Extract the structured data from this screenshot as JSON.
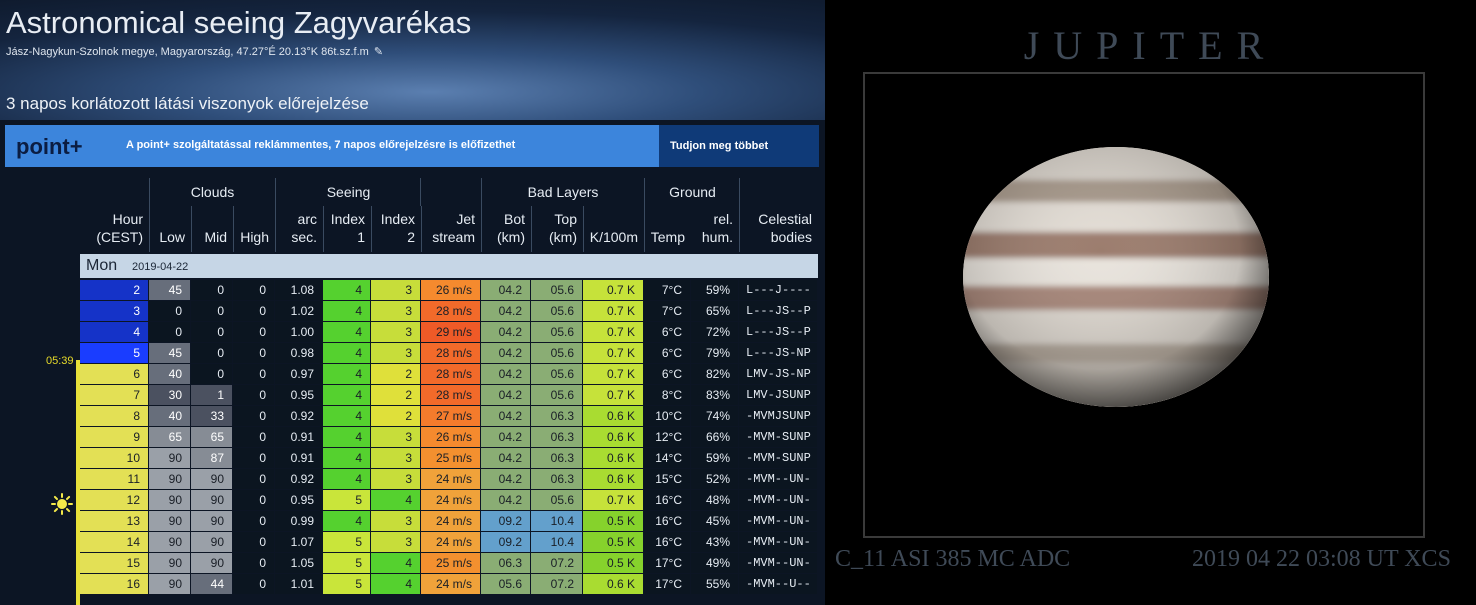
{
  "site": {
    "title": "Astronomical seeing Zagyvarékas",
    "location": "Jász-Nagykun-Szolnok megye, Magyarország, 47.27°É 20.13°K 86t.sz.f.m",
    "edit_icon": "edit-icon"
  },
  "forecast": {
    "heading": "3 napos korlátozott látási viszonyok előrejelzése"
  },
  "promo": {
    "logo": "point+",
    "text": "A point+ szolgáltatással reklámmentes, 7 napos előrejelzésre is előfizethet",
    "link": "Tudjon meg többet"
  },
  "table": {
    "group_headers": [
      "Clouds",
      "Seeing",
      "Bad Layers",
      "Ground"
    ],
    "headers": {
      "hour": [
        "Hour",
        "(CEST)"
      ],
      "low": "Low",
      "mid": "Mid",
      "high": "High",
      "arc": [
        "arc",
        "sec."
      ],
      "index1": [
        "Index",
        "1"
      ],
      "index2": [
        "Index",
        "2"
      ],
      "jet": [
        "Jet",
        "stream"
      ],
      "bot": [
        "Bot",
        "(km)"
      ],
      "top": [
        "Top",
        "(km)"
      ],
      "k100": "K/100m",
      "temp": "Temp",
      "hum": [
        "rel.",
        "hum."
      ],
      "celestial": [
        "Celestial",
        "bodies"
      ]
    },
    "day": {
      "name": "Mon",
      "date": "2019-04-22"
    },
    "sunrise": "05:39",
    "sun_icon": "sun-icon",
    "rows": [
      {
        "hour": "2",
        "low": "45",
        "mid": "0",
        "high": "0",
        "arc": "1.08",
        "i1": "4",
        "i2": "3",
        "jet": "26 m/s",
        "bot": "04.2",
        "top": "05.6",
        "k": "0.7 K",
        "temp": "7°C",
        "hum": "59%",
        "bodies": "L---J----"
      },
      {
        "hour": "3",
        "low": "0",
        "mid": "0",
        "high": "0",
        "arc": "1.02",
        "i1": "4",
        "i2": "3",
        "jet": "28 m/s",
        "bot": "04.2",
        "top": "05.6",
        "k": "0.7 K",
        "temp": "7°C",
        "hum": "65%",
        "bodies": "L---JS--P"
      },
      {
        "hour": "4",
        "low": "0",
        "mid": "0",
        "high": "0",
        "arc": "1.00",
        "i1": "4",
        "i2": "3",
        "jet": "29 m/s",
        "bot": "04.2",
        "top": "05.6",
        "k": "0.7 K",
        "temp": "6°C",
        "hum": "72%",
        "bodies": "L---JS--P"
      },
      {
        "hour": "5",
        "low": "45",
        "mid": "0",
        "high": "0",
        "arc": "0.98",
        "i1": "4",
        "i2": "3",
        "jet": "28 m/s",
        "bot": "04.2",
        "top": "05.6",
        "k": "0.7 K",
        "temp": "6°C",
        "hum": "79%",
        "bodies": "L---JS-NP"
      },
      {
        "hour": "6",
        "low": "40",
        "mid": "0",
        "high": "0",
        "arc": "0.97",
        "i1": "4",
        "i2": "2",
        "jet": "28 m/s",
        "bot": "04.2",
        "top": "05.6",
        "k": "0.7 K",
        "temp": "6°C",
        "hum": "82%",
        "bodies": "LMV-JS-NP"
      },
      {
        "hour": "7",
        "low": "30",
        "mid": "1",
        "high": "0",
        "arc": "0.95",
        "i1": "4",
        "i2": "2",
        "jet": "28 m/s",
        "bot": "04.2",
        "top": "05.6",
        "k": "0.7 K",
        "temp": "8°C",
        "hum": "83%",
        "bodies": "LMV-JSUNP"
      },
      {
        "hour": "8",
        "low": "40",
        "mid": "33",
        "high": "0",
        "arc": "0.92",
        "i1": "4",
        "i2": "2",
        "jet": "27 m/s",
        "bot": "04.2",
        "top": "06.3",
        "k": "0.6 K",
        "temp": "10°C",
        "hum": "74%",
        "bodies": "-MVMJSUNP"
      },
      {
        "hour": "9",
        "low": "65",
        "mid": "65",
        "high": "0",
        "arc": "0.91",
        "i1": "4",
        "i2": "3",
        "jet": "26 m/s",
        "bot": "04.2",
        "top": "06.3",
        "k": "0.6 K",
        "temp": "12°C",
        "hum": "66%",
        "bodies": "-MVM-SUNP"
      },
      {
        "hour": "10",
        "low": "90",
        "mid": "87",
        "high": "0",
        "arc": "0.91",
        "i1": "4",
        "i2": "3",
        "jet": "25 m/s",
        "bot": "04.2",
        "top": "06.3",
        "k": "0.6 K",
        "temp": "14°C",
        "hum": "59%",
        "bodies": "-MVM-SUNP"
      },
      {
        "hour": "11",
        "low": "90",
        "mid": "90",
        "high": "0",
        "arc": "0.92",
        "i1": "4",
        "i2": "3",
        "jet": "24 m/s",
        "bot": "04.2",
        "top": "06.3",
        "k": "0.6 K",
        "temp": "15°C",
        "hum": "52%",
        "bodies": "-MVM--UN-"
      },
      {
        "hour": "12",
        "low": "90",
        "mid": "90",
        "high": "0",
        "arc": "0.95",
        "i1": "5",
        "i2": "4",
        "jet": "24 m/s",
        "bot": "04.2",
        "top": "05.6",
        "k": "0.7 K",
        "temp": "16°C",
        "hum": "48%",
        "bodies": "-MVM--UN-"
      },
      {
        "hour": "13",
        "low": "90",
        "mid": "90",
        "high": "0",
        "arc": "0.99",
        "i1": "4",
        "i2": "3",
        "jet": "24 m/s",
        "bot": "09.2",
        "top": "10.4",
        "k": "0.5 K",
        "temp": "16°C",
        "hum": "45%",
        "bodies": "-MVM--UN-"
      },
      {
        "hour": "14",
        "low": "90",
        "mid": "90",
        "high": "0",
        "arc": "1.07",
        "i1": "5",
        "i2": "3",
        "jet": "24 m/s",
        "bot": "09.2",
        "top": "10.4",
        "k": "0.5 K",
        "temp": "16°C",
        "hum": "43%",
        "bodies": "-MVM--UN-"
      },
      {
        "hour": "15",
        "low": "90",
        "mid": "90",
        "high": "0",
        "arc": "1.05",
        "i1": "5",
        "i2": "4",
        "jet": "25 m/s",
        "bot": "06.3",
        "top": "07.2",
        "k": "0.5 K",
        "temp": "17°C",
        "hum": "49%",
        "bodies": "-MVM--UN-"
      },
      {
        "hour": "16",
        "low": "90",
        "mid": "44",
        "high": "0",
        "arc": "1.01",
        "i1": "5",
        "i2": "4",
        "jet": "24 m/s",
        "bot": "05.6",
        "top": "07.2",
        "k": "0.6 K",
        "temp": "17°C",
        "hum": "55%",
        "bodies": "-MVM--U--"
      }
    ]
  },
  "colors": {
    "hour_night": "#1533c8",
    "hour_dawn": "#1a3dff",
    "hour_day": "#e3e055",
    "index_4": "#55d12f",
    "index_5": "#c9e53a",
    "bad_layer_green": "#8aad74",
    "bad_layer_blue": "#63a0cc",
    "k_yellow": "#c6e23a",
    "k_green": "#86d22c",
    "dark_cell": "#0b1520"
  },
  "image": {
    "title": "JUPITER",
    "caption_left": "C_11 ASI 385 MC ADC",
    "caption_right": "2019 04 22 03:08 UT  XCS",
    "planet_icon": "jupiter-planet"
  }
}
